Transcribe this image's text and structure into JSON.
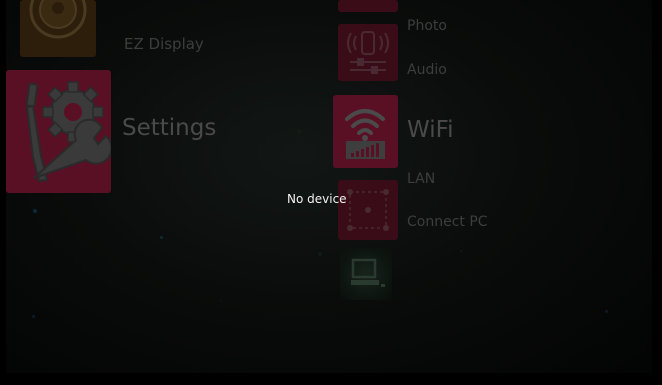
{
  "menu": {
    "left": {
      "ez_display": {
        "label": "EZ Display",
        "icon": "ez-display-icon"
      },
      "settings": {
        "label": "Settings",
        "icon": "settings-tools-icon",
        "state": "selected"
      }
    },
    "right": {
      "photo": {
        "label": "Photo",
        "icon": "photo-icon"
      },
      "audio": {
        "label": "Audio",
        "icon": "audio-speaker-icon"
      },
      "wifi": {
        "label": "WiFi",
        "icon": "wifi-signal-icon",
        "state": "highlighted"
      },
      "lan": {
        "label": "LAN",
        "icon": "lan-network-icon"
      },
      "connect_pc": {
        "label": "Connect PC",
        "icon": "computer-icon"
      }
    }
  },
  "toast": {
    "message": "No device"
  },
  "colors": {
    "accent_selected": "#c4184a",
    "accent_dim": "#5a1024",
    "text_dim": "#3d3d3d",
    "text_selected_dim": "#4a4a4a",
    "toast_text": "#f2f2f2",
    "background": "#0a0c0b"
  }
}
